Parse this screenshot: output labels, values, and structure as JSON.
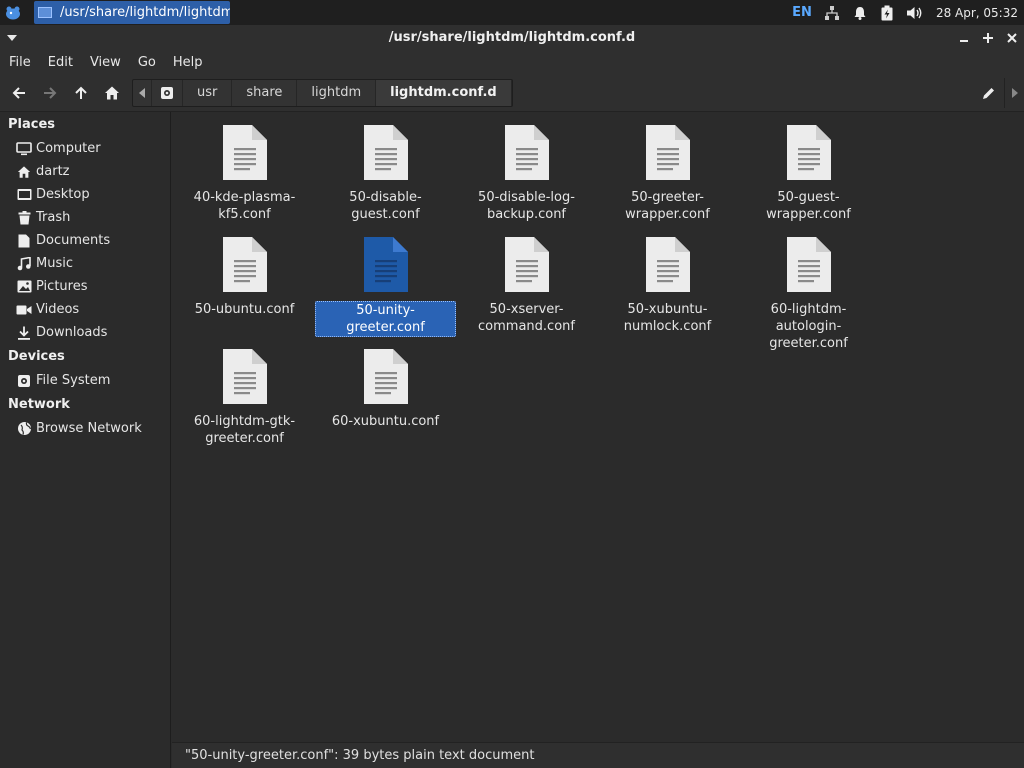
{
  "panel": {
    "task_label": "/usr/share/lightdm/lightdm....",
    "keyboard_layout": "EN",
    "clock": "28 Apr, 05:32"
  },
  "window": {
    "title": "/usr/share/lightdm/lightdm.conf.d"
  },
  "menubar": {
    "items": [
      "File",
      "Edit",
      "View",
      "Go",
      "Help"
    ]
  },
  "breadcrumbs": [
    "usr",
    "share",
    "lightdm",
    "lightdm.conf.d"
  ],
  "sidebar": {
    "places_heading": "Places",
    "places": [
      {
        "label": "Computer",
        "icon": "computer-icon"
      },
      {
        "label": "dartz",
        "icon": "home-icon"
      },
      {
        "label": "Desktop",
        "icon": "desktop-icon"
      },
      {
        "label": "Trash",
        "icon": "trash-icon"
      },
      {
        "label": "Documents",
        "icon": "documents-icon"
      },
      {
        "label": "Music",
        "icon": "music-icon"
      },
      {
        "label": "Pictures",
        "icon": "pictures-icon"
      },
      {
        "label": "Videos",
        "icon": "videos-icon"
      },
      {
        "label": "Downloads",
        "icon": "downloads-icon"
      }
    ],
    "devices_heading": "Devices",
    "devices": [
      {
        "label": "File System",
        "icon": "drive-icon"
      }
    ],
    "network_heading": "Network",
    "network": [
      {
        "label": "Browse Network",
        "icon": "network-icon"
      }
    ]
  },
  "files": [
    {
      "name": "40-kde-plasma-kf5.conf",
      "lines": [
        "40-kde-plasma-",
        "kf5.conf"
      ]
    },
    {
      "name": "50-disable-guest.conf",
      "lines": [
        "50-disable-guest.conf"
      ]
    },
    {
      "name": "50-disable-log-backup.conf",
      "lines": [
        "50-disable-log-",
        "backup.conf"
      ]
    },
    {
      "name": "50-greeter-wrapper.conf",
      "lines": [
        "50-greeter-",
        "wrapper.conf"
      ]
    },
    {
      "name": "50-guest-wrapper.conf",
      "lines": [
        "50-guest-wrapper.conf"
      ]
    },
    {
      "name": "50-ubuntu.conf",
      "lines": [
        "50-ubuntu.conf"
      ]
    },
    {
      "name": "50-unity-greeter.conf",
      "lines": [
        "50-unity-greeter.conf"
      ],
      "selected": true
    },
    {
      "name": "50-xserver-command.conf",
      "lines": [
        "50-xserver-",
        "command.conf"
      ]
    },
    {
      "name": "50-xubuntu-numlock.conf",
      "lines": [
        "50-xubuntu-",
        "numlock.conf"
      ]
    },
    {
      "name": "60-lightdm-autologin-greeter.conf",
      "lines": [
        "60-lightdm-autologin-",
        "greeter.conf"
      ]
    },
    {
      "name": "60-lightdm-gtk-greeter.conf",
      "lines": [
        "60-lightdm-gtk-",
        "greeter.conf"
      ]
    },
    {
      "name": "60-xubuntu.conf",
      "lines": [
        "60-xubuntu.conf"
      ]
    }
  ],
  "statusbar": {
    "text": "\"50-unity-greeter.conf\": 39 bytes plain text document"
  },
  "colors": {
    "selection": "#2a63b5",
    "selected_icon": "#1e5aa8",
    "keyboard_layout": "#5aa9ff"
  }
}
